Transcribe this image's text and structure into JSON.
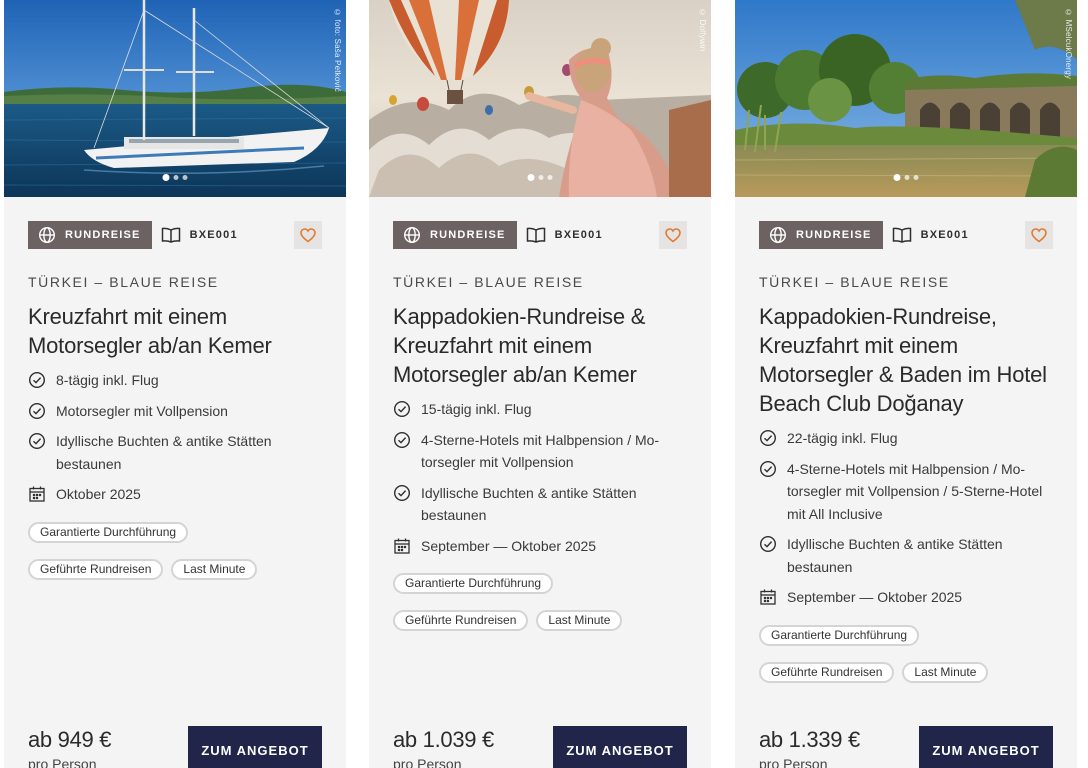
{
  "colors": {
    "card_background": "#f4f4f4",
    "badge_background": "#6d6262",
    "button_background": "#22254a",
    "heart_accent": "#e07a2e"
  },
  "offers": [
    {
      "photo_credit": "© foto: Saša Petković",
      "image_subject": "sailing-yacht-on-sea",
      "type_label": "RUNDREISE",
      "code": "BXE001",
      "region": "TÜRKEI – BLAUE REISE",
      "title": "Kreuzfahrt mit einem Motorsegler ab/an Kemer",
      "features": [
        {
          "icon": "check-circle-icon",
          "text": "8-tägig inkl. Flug"
        },
        {
          "icon": "check-circle-icon",
          "text": "Motorsegler mit Vollpension"
        },
        {
          "icon": "check-circle-icon",
          "text": "Idyllische Buchten & antike Stätten bestaunen"
        },
        {
          "icon": "calendar-icon",
          "text": "Oktober 2025"
        }
      ],
      "tags": [
        "Garantierte Durchführung",
        "Geführte Rundreisen",
        "Last Minute"
      ],
      "price": "ab 949 €",
      "price_unit": "pro Person",
      "cta_label": "ZUM ANGEBOT"
    },
    {
      "photo_credit": "© Dolfywin",
      "image_subject": "hot-air-balloons-cappadocia",
      "type_label": "RUNDREISE",
      "code": "BXE001",
      "region": "TÜRKEI – BLAUE REISE",
      "title": "Kappadokien-Rundreise & Kreuzfahrt mit einem Motorsegler ab/an Kemer",
      "features": [
        {
          "icon": "check-circle-icon",
          "text": "15-tägig inkl. Flug"
        },
        {
          "icon": "check-circle-icon",
          "text": "4-Sterne-Hotels mit Halbpension / Mo-torsegler mit Vollpension"
        },
        {
          "icon": "check-circle-icon",
          "text": "Idyllische Buchten & antike Stätten bestaunen"
        },
        {
          "icon": "calendar-icon",
          "text": "September — Oktober 2025"
        }
      ],
      "tags": [
        "Garantierte Durchführung",
        "Geführte Rundreisen",
        "Last Minute"
      ],
      "price": "ab 1.039 €",
      "price_unit": "pro Person",
      "cta_label": "ZUM ANGEBOT"
    },
    {
      "photo_credit": "© MSelcukOnergy",
      "image_subject": "ancient-ruins-by-river",
      "type_label": "RUNDREISE",
      "code": "BXE001",
      "region": "TÜRKEI – BLAUE REISE",
      "title": "Kappadokien-Rundreise, Kreuzfahrt mit einem Motorsegler & Baden im Hotel Beach Club Doğanay",
      "features": [
        {
          "icon": "check-circle-icon",
          "text": "22-tägig inkl. Flug"
        },
        {
          "icon": "check-circle-icon",
          "text": "4-Sterne-Hotels mit Halbpension / Mo-torsegler mit Vollpension / 5-Sterne-Hotel mit All Inclusive"
        },
        {
          "icon": "check-circle-icon",
          "text": "Idyllische Buchten & antike Stätten bestaunen"
        },
        {
          "icon": "calendar-icon",
          "text": "September — Oktober 2025"
        }
      ],
      "tags": [
        "Garantierte Durchführung",
        "Geführte Rundreisen",
        "Last Minute"
      ],
      "price": "ab 1.339 €",
      "price_unit": "pro Person",
      "cta_label": "ZUM ANGEBOT"
    }
  ]
}
